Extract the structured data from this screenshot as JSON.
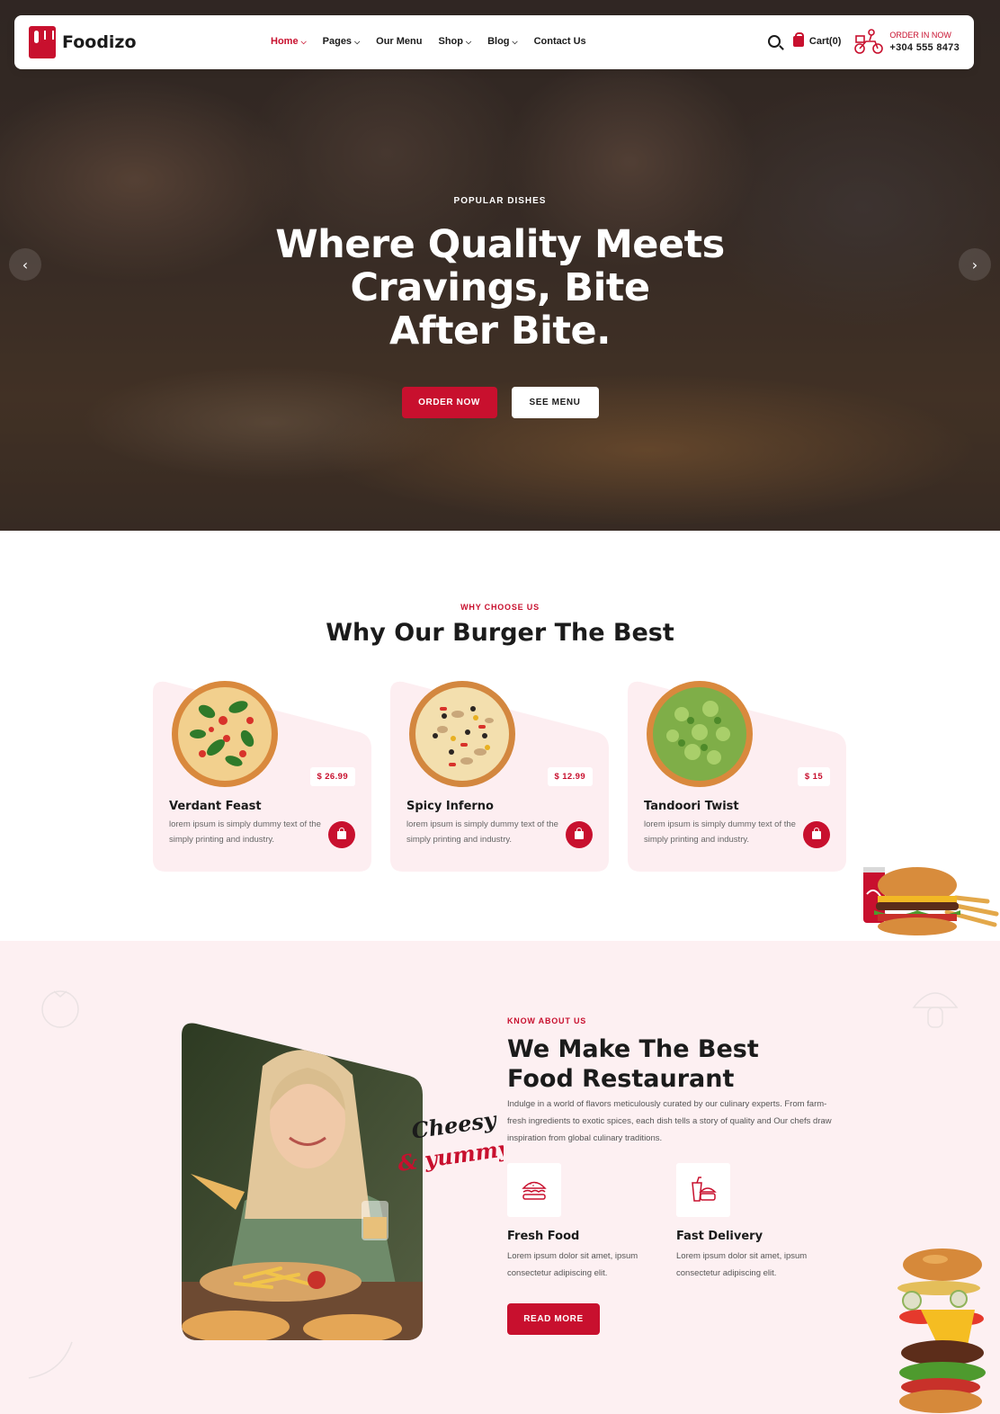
{
  "nav": {
    "logo_text": "Foodizo",
    "menu": [
      {
        "label": "Home",
        "has_dropdown": true,
        "active": true
      },
      {
        "label": "Pages",
        "has_dropdown": true,
        "active": false
      },
      {
        "label": "Our Menu",
        "has_dropdown": false,
        "active": false
      },
      {
        "label": "Shop",
        "has_dropdown": true,
        "active": false
      },
      {
        "label": "Blog",
        "has_dropdown": true,
        "active": false
      },
      {
        "label": "Contact Us",
        "has_dropdown": false,
        "active": false
      }
    ],
    "cart_label": "Cart(0)",
    "order_label": "ORDER IN NOW",
    "order_phone": "+304 555 8473"
  },
  "hero": {
    "eyebrow": "POPULAR DISHES",
    "title_line1": "Where Quality Meets",
    "title_line2": "Cravings, Bite",
    "title_line3": "After Bite.",
    "order_button": "ORDER NOW",
    "menu_button": "SEE MENU",
    "prev_arrow": "‹",
    "next_arrow": "›"
  },
  "why": {
    "eyebrow": "WHY CHOOSE US",
    "title": "Why Our Burger The Best",
    "cards": [
      {
        "name": "Verdant Feast",
        "price": "$ 26.99",
        "desc": "lorem ipsum is simply dummy text of the simply printing and industry."
      },
      {
        "name": "Spicy Inferno",
        "price": "$ 12.99",
        "desc": "lorem ipsum is simply dummy text of the simply printing and industry."
      },
      {
        "name": "Tandoori Twist",
        "price": "$ 15",
        "desc": "lorem ipsum is simply dummy text of the simply printing and industry."
      }
    ]
  },
  "about": {
    "eyebrow": "KNOW ABOUT US",
    "title_line1": "We Make The Best",
    "title_line2": "Food Restaurant",
    "desc": "Indulge in a world of flavors meticulously curated by our culinary experts. From farm-fresh ingredients to exotic spices, each dish tells a story of quality and Our chefs draw inspiration from global culinary traditions.",
    "cheesy_word1": "Cheesy",
    "cheesy_word2": "& yummy",
    "features": [
      {
        "name": "Fresh Food",
        "desc": "Lorem ipsum dolor sit amet, ipsum consectetur adipiscing elit."
      },
      {
        "name": "Fast Delivery",
        "desc": "Lorem ipsum dolor sit amet, ipsum consectetur adipiscing elit."
      }
    ],
    "read_more": "READ MORE"
  },
  "colors": {
    "accent": "#c8102e",
    "pink_bg": "#fdf0f2",
    "card_bg": "#fdeef1",
    "dark": "#1b1b1b"
  }
}
